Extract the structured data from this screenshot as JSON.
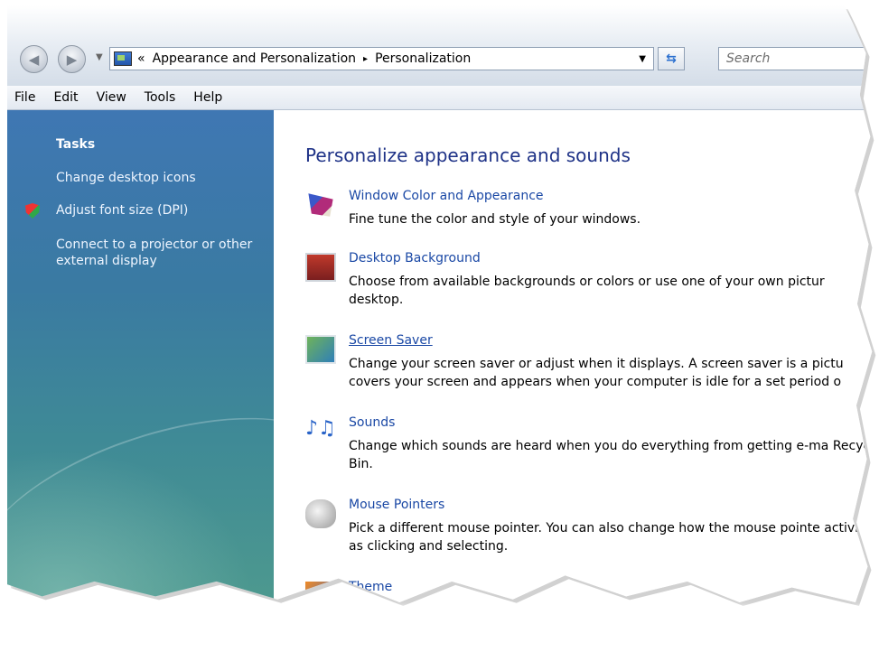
{
  "address_bar": {
    "breadcrumb_prefix": "«",
    "crumb_1": "Appearance and Personalization",
    "crumb_separator": "▸",
    "crumb_2": "Personalization",
    "search_placeholder": "Search"
  },
  "menu": [
    "File",
    "Edit",
    "View",
    "Tools",
    "Help"
  ],
  "sidebar": {
    "heading": "Tasks",
    "items": [
      "Change desktop icons",
      "Adjust font size (DPI)",
      "Connect to a projector or other external display"
    ]
  },
  "main": {
    "title": "Personalize appearance and sounds",
    "items": [
      {
        "label": "Window Color and Appearance",
        "desc": "Fine tune the color and style of your windows.",
        "icon": "window-color-icon"
      },
      {
        "label": "Desktop Background",
        "desc": "Choose from available backgrounds or colors or use one of your own pictur desktop.",
        "icon": "desktop-background-icon"
      },
      {
        "label": "Screen Saver",
        "desc": "Change your screen saver or adjust when it displays. A screen saver is a pictu covers your screen and appears when your computer is idle for a set period o",
        "icon": "screen-saver-icon"
      },
      {
        "label": "Sounds",
        "desc": "Change which sounds are heard when you do everything from getting e-ma Recycle Bin.",
        "icon": "sounds-icon"
      },
      {
        "label": "Mouse Pointers",
        "desc": "Pick a different mouse pointer. You can also change how the mouse pointe activities as clicking and selecting.",
        "icon": "mouse-pointers-icon"
      },
      {
        "label": "Theme",
        "desc": "",
        "icon": "theme-icon"
      }
    ]
  }
}
